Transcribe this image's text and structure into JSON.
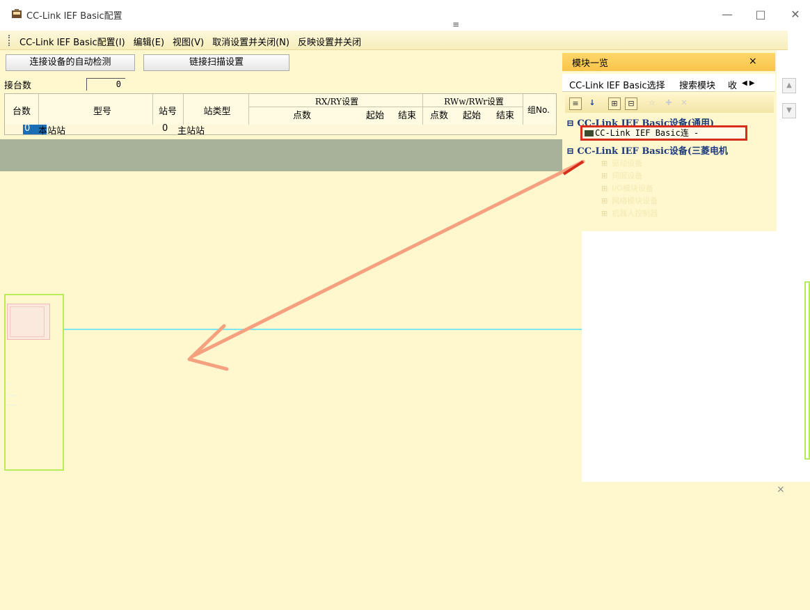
{
  "window": {
    "title": "CC-Link IEF Basic配置",
    "min_label": "—",
    "max_label": "□",
    "close_label": "✕",
    "drag_handle": "≡"
  },
  "menubar": {
    "items": [
      "CC-Link IEF Basic配置(I)",
      "编辑(E)",
      "视图(V)",
      "取消设置并关闭(N)",
      "反映设置并关闭"
    ]
  },
  "toolbar": {
    "auto_detect": "连接设备的自动检测",
    "link_scan": "链接扫描设置"
  },
  "count": {
    "label": "接台数",
    "value": "0"
  },
  "table": {
    "headers": {
      "count": "台数",
      "model": "型号",
      "station_no": "站号",
      "station_type": "站类型",
      "rxry": "RX/RY设置",
      "rwwrwr": "RWw/RWr设置",
      "points": "点数",
      "start": "起始",
      "end": "结束",
      "group": "组No."
    },
    "rows": [
      {
        "count": "0",
        "model": "本站站",
        "station_no": "0",
        "station_type": "主站站"
      }
    ]
  },
  "panel": {
    "title": "模块一览",
    "close_label": "×",
    "tabs": [
      "CC-Link IEF Basic选择",
      "搜索模块",
      "收"
    ],
    "tab_scroll": "◀ ▶",
    "tree": {
      "group1": "⊟ CC-Link IEF Basic设备(通用)",
      "selected_item": "CC-Link IEF Basic连 -",
      "group2": "⊟ CC-Link IEF Basic设备(三菱电机",
      "leaves": [
        "驱动设备",
        "伺服设备",
        "I/O模块设备",
        "网络模块设备",
        "机器人控制器"
      ]
    }
  },
  "output": {
    "close_label": "×"
  },
  "colors": {
    "menubar": "#f7edbb",
    "panel_title": "#f8c44a",
    "highlight_border": "#d72d1a",
    "arrow": "#f5a07e",
    "link_line": "#7ee6ee",
    "node_border": "#b6ec5a"
  }
}
